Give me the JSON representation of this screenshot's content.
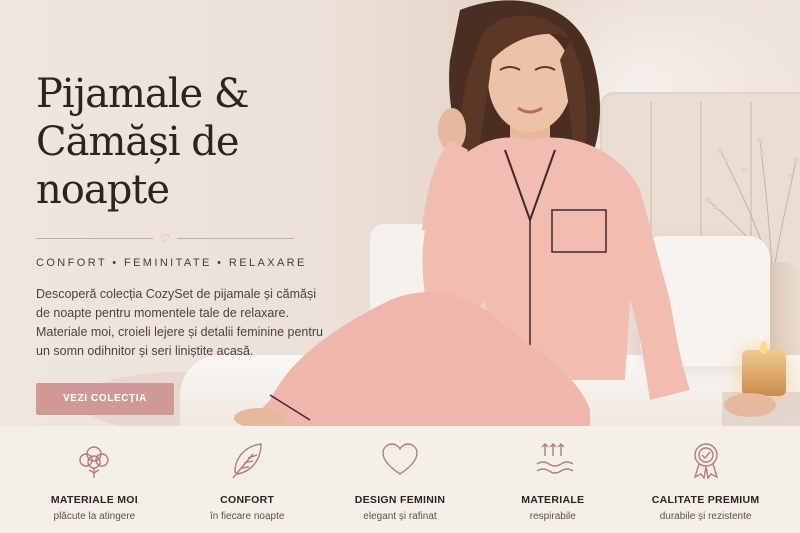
{
  "hero": {
    "title": "Pijamale &\nCămăși de noapte",
    "tagline": "CONFORT • FEMINITATE • RELAXARE",
    "description": "Descoperă colecția CozySet de pijamale și cămăși de noapte pentru momentele tale de relaxare. Materiale moi, croieli lejere și detalii feminine pentru un somn odihnitor și seri liniștite acasă.",
    "cta_label": "VEZI COLECȚIA",
    "accent_color": "#cf9a95"
  },
  "features": [
    {
      "icon": "cotton-flower-icon",
      "title": "MATERIALE MOI",
      "subtitle": "plăcute la atingere"
    },
    {
      "icon": "feather-icon",
      "title": "CONFORT",
      "subtitle": "în fiecare noapte"
    },
    {
      "icon": "heart-icon",
      "title": "DESIGN FEMININ",
      "subtitle": "elegant și rafinat"
    },
    {
      "icon": "breathable-icon",
      "title": "MATERIALE",
      "subtitle": "respirabile"
    },
    {
      "icon": "award-badge-icon",
      "title": "CALITATE PREMIUM",
      "subtitle": "durabile și rezistente"
    }
  ]
}
